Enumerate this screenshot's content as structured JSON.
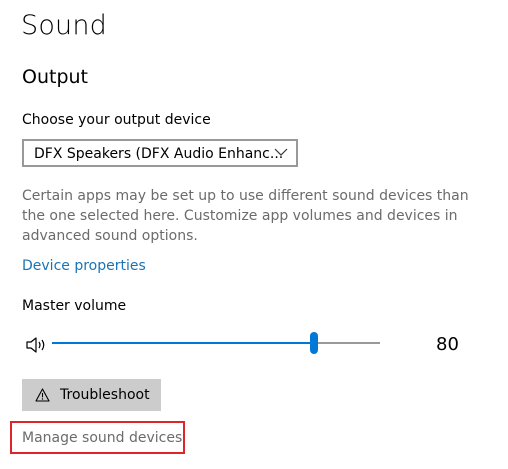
{
  "page": {
    "title": "Sound",
    "section_title": "Output"
  },
  "output": {
    "device_label": "Choose your output device",
    "device_selected": "DFX Speakers (DFX Audio Enhanc...",
    "description": "Certain apps may be set up to use different sound devices than the one selected here. Customize app volumes and devices in advanced sound options.",
    "device_properties_link": "Device properties",
    "master_volume_label": "Master volume",
    "master_volume_value": "80",
    "volume_fraction": 0.8,
    "troubleshoot_label": "Troubleshoot",
    "manage_devices_label": "Manage sound devices"
  },
  "icons": {
    "dropdown": "chevron-down-icon",
    "speaker": "speaker-icon",
    "troubleshoot": "warning-icon"
  },
  "colors": {
    "accent": "#0078d7",
    "link": "#1a73b5",
    "highlight_box": "#e0242b",
    "button_bg": "#cccccc"
  }
}
